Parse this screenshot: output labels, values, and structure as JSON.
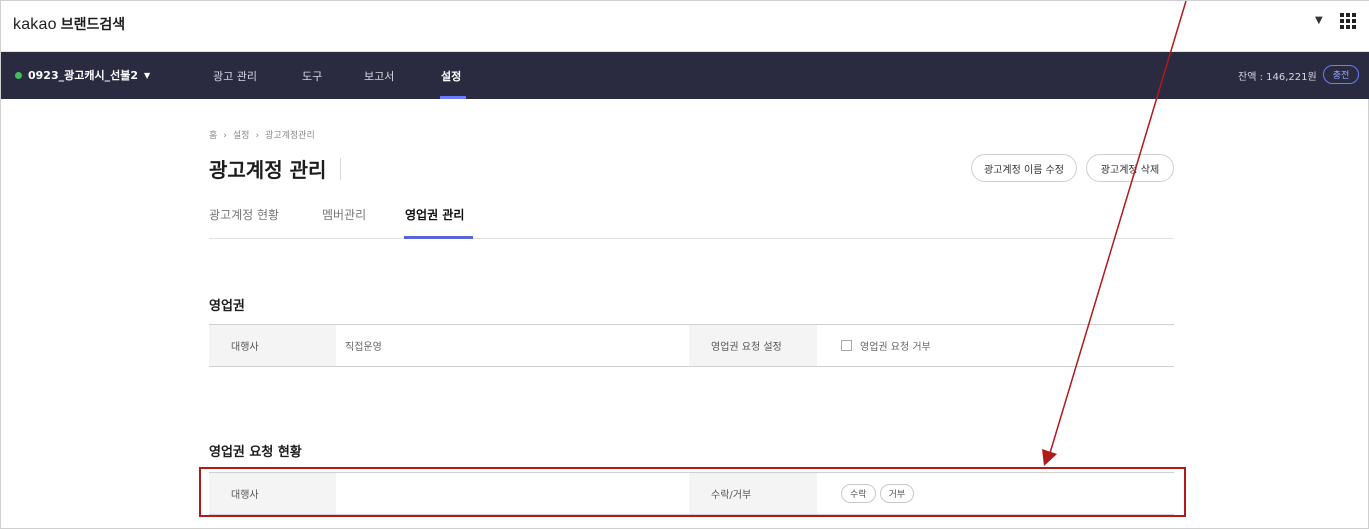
{
  "header": {
    "brand": "kakao",
    "service": "브랜드검색"
  },
  "navbar": {
    "account": "0923_광고캐시_선불2",
    "items": [
      {
        "label": "광고 관리"
      },
      {
        "label": "도구"
      },
      {
        "label": "보고서"
      },
      {
        "label": "설정"
      }
    ],
    "balance": "잔액 : 146,221원",
    "charge_label": "충전"
  },
  "breadcrumb": [
    "홈",
    "›",
    "설정",
    "›",
    "광고계정관리"
  ],
  "page": {
    "title": "광고계정 관리",
    "rename_button": "광고계정 이름 수정",
    "delete_button": "광고계정 삭제"
  },
  "tabs": [
    {
      "label": "광고계정 현황"
    },
    {
      "label": "멤버관리"
    },
    {
      "label": "영업권 관리"
    }
  ],
  "sales_rights": {
    "title": "영업권",
    "agency_label": "대행사",
    "agency_value": "직접운영",
    "request_setting_label": "영업권 요청 설정",
    "reject_checkbox_label": "영업권 요청 거부"
  },
  "request_status": {
    "title": "영업권 요청 현황",
    "agency_label": "대행사",
    "agency_value": "",
    "accept_reject_label": "수락/거부",
    "accept_button": "수락",
    "reject_button": "거부"
  },
  "colors": {
    "nav_bg": "#2a2b40",
    "accent": "#5a66d6",
    "status_dot": "#39c354",
    "annotation": "#b11a1a"
  }
}
